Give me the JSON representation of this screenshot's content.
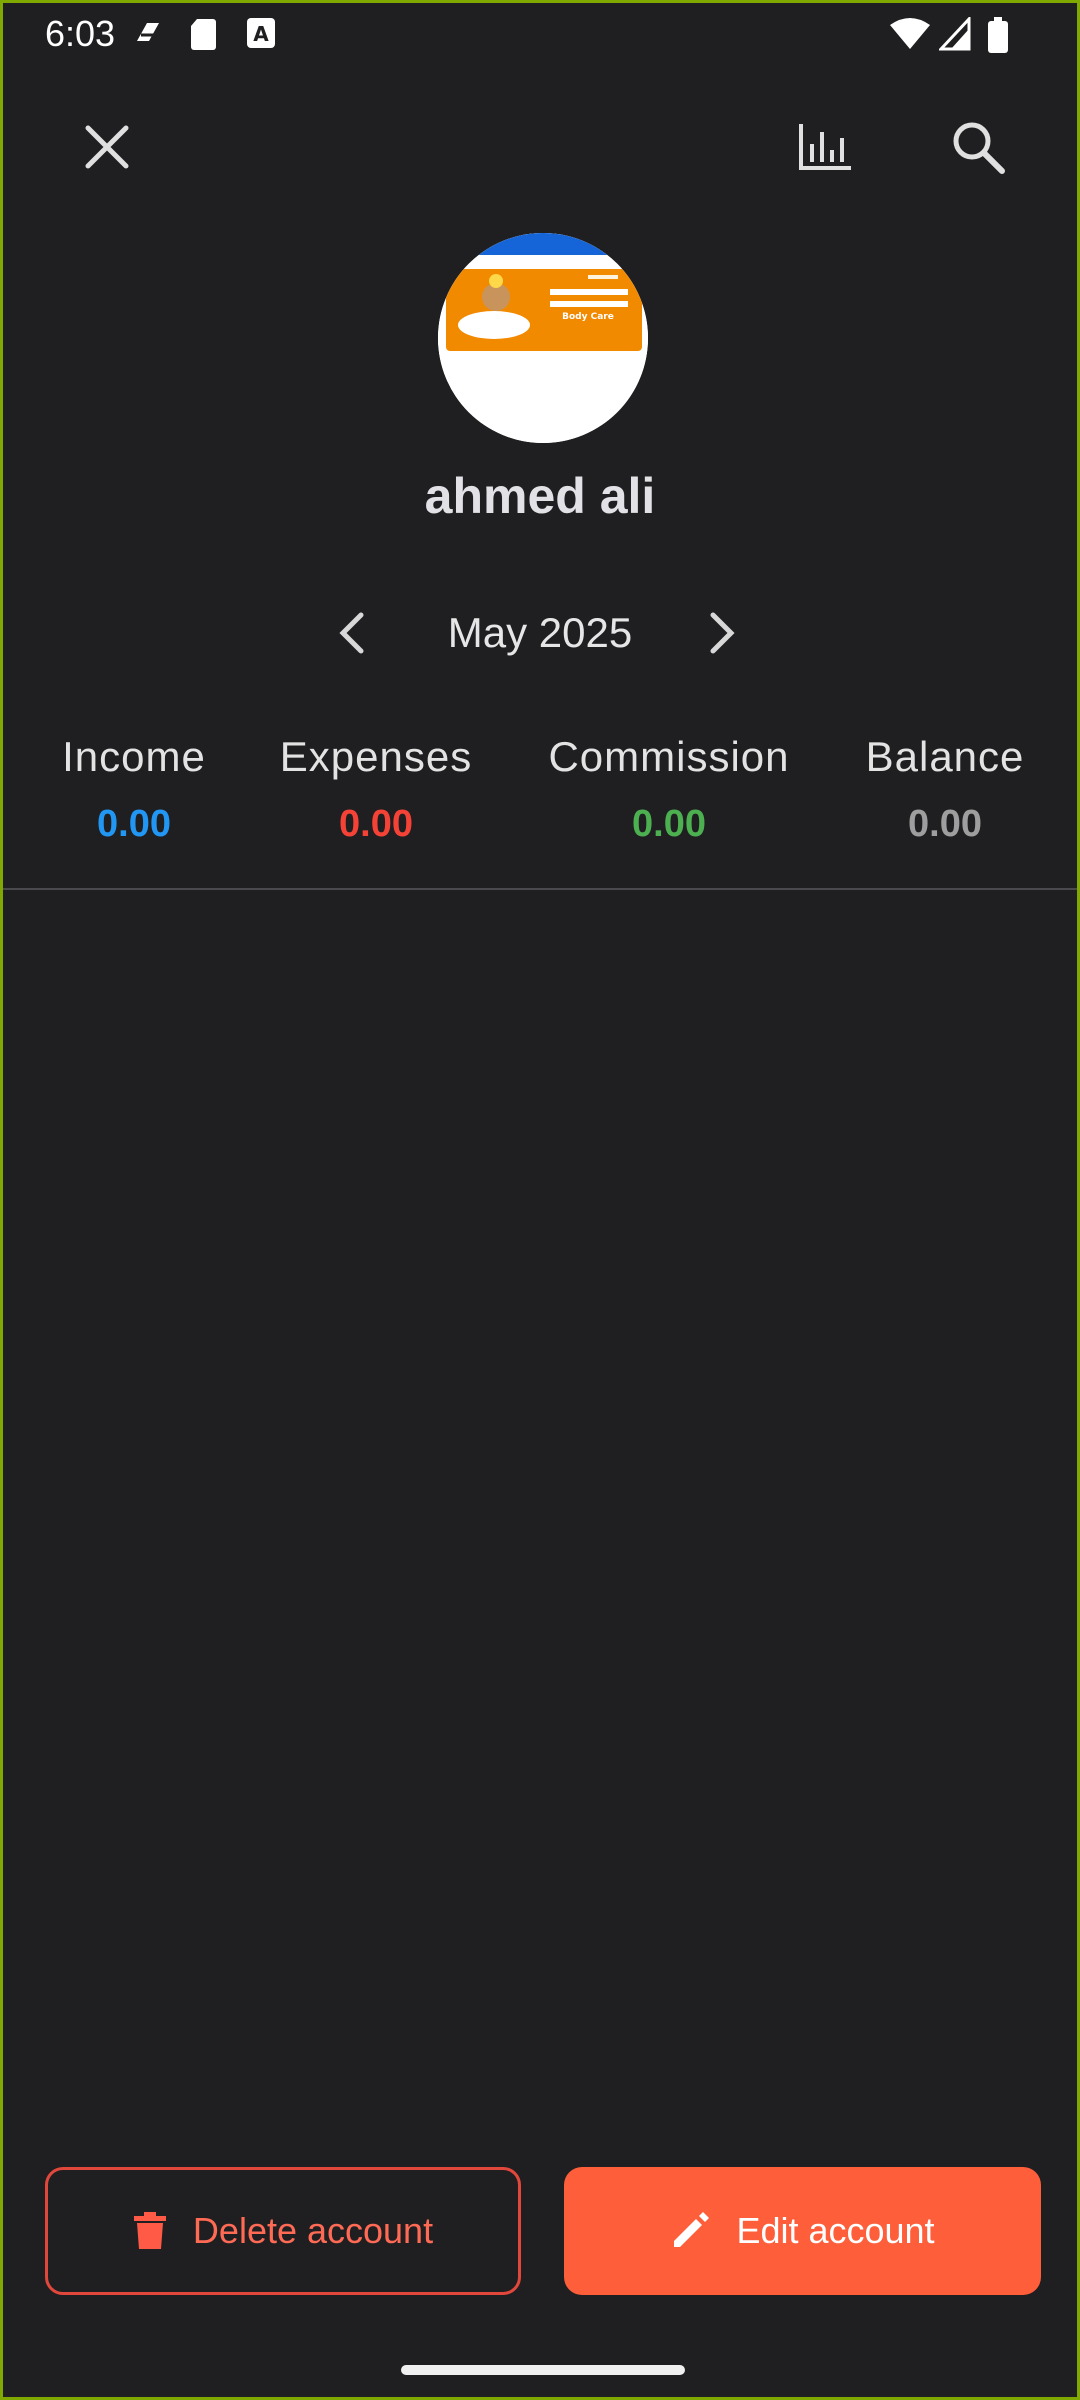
{
  "status_bar": {
    "time": "6:03",
    "icons": [
      "notification-icon",
      "sd-card-icon",
      "keyboard-a-icon",
      "wifi-icon",
      "signal-icon",
      "battery-icon"
    ]
  },
  "toolbar": {
    "icons": [
      "close-icon",
      "bar-chart-icon",
      "search-icon"
    ]
  },
  "profile": {
    "name": "ahmed ali",
    "avatar_text": "Body Care"
  },
  "period": {
    "label": "May 2025"
  },
  "summary": [
    {
      "label": "Income",
      "value": "0.00",
      "color": "#2196f3"
    },
    {
      "label": "Expenses",
      "value": "0.00",
      "color": "#f44336"
    },
    {
      "label": "Commission",
      "value": "0.00",
      "color": "#4caf50"
    },
    {
      "label": "Balance",
      "value": "0.00",
      "color": "#9e9e9e"
    }
  ],
  "actions": {
    "delete_label": "Delete account",
    "edit_label": "Edit account"
  },
  "colors": {
    "background": "#1f1f22",
    "accent": "#ff5e3a",
    "danger": "#e1473a"
  }
}
